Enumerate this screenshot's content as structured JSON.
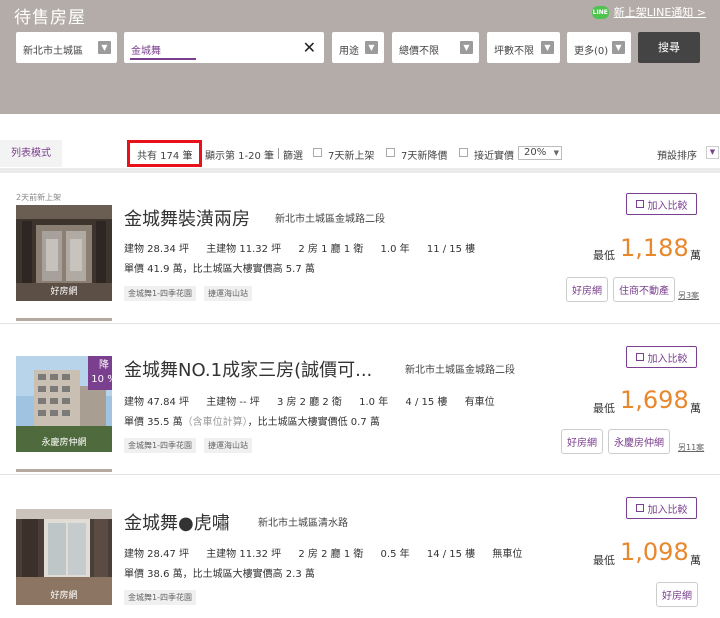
{
  "header": {
    "title": "待售房屋",
    "line_badge": "LINE",
    "line_link": "新上架LINE通知 >"
  },
  "filters": {
    "region": "新北市土城區",
    "keyword": "金城舞",
    "usage": "用途",
    "total_price": "總價不限",
    "ping": "坪數不限",
    "more": "更多(0)",
    "search_button": "搜尋"
  },
  "toolbar": {
    "list_mode": "列表模式",
    "total": "共有 174 筆",
    "showing": "顯示第 1-20 筆",
    "filter": "篩選",
    "new_7days": "7天新上架",
    "price_drop_7days": "7天新降價",
    "near_actual": "接近實價",
    "pct": "20%",
    "sort": "預設排序"
  },
  "listings": [
    {
      "tagline": "2天前新上架",
      "title": "金城舞裝潢兩房",
      "address": "新北市土城區金城路二段",
      "specs": [
        "建物 28.34 坪",
        "主建物 11.32 坪",
        "2 房 1 廳 1 衛",
        "1.0 年",
        "11 / 15 樓"
      ],
      "unit_price": "單價 41.9 萬，比土城區大樓實價高 5.7 萬",
      "unit_note": "",
      "tags": [
        "金城舞1-四季花園",
        "捷運海山站"
      ],
      "compare": "加入比較",
      "price_low_label": "最低",
      "price": "1,188",
      "price_unit": "萬",
      "agents": [
        "好房網",
        "住商不動產"
      ],
      "more_cases": "另3案",
      "thumb_brand": "好房網"
    },
    {
      "tagline": "",
      "title": "金城舞NO.1成家三房(誠價可...",
      "address": "新北市土城區金城路二段",
      "specs": [
        "建物 47.84 坪",
        "主建物 -- 坪",
        "3 房 2 廳 2 衛",
        "1.0 年",
        "4 / 15 樓",
        "有車位"
      ],
      "unit_price": "單價 35.5 萬",
      "unit_note": "（含車位計算）",
      "unit_rest": "，比土城區大樓實價低 0.7 萬",
      "tags": [
        "金城舞1-四季花園",
        "捷運海山站"
      ],
      "compare": "加入比較",
      "price_low_label": "最低",
      "price": "1,698",
      "price_unit": "萬",
      "agents": [
        "好房網",
        "永慶房仲網"
      ],
      "more_cases": "另11案",
      "thumb_brand": "永慶房仲網",
      "discount": [
        "降",
        "10 %"
      ]
    },
    {
      "tagline": "",
      "title": "金城舞●虎嘯",
      "address": "新北市土城區清水路",
      "specs": [
        "建物 28.47 坪",
        "主建物 11.32 坪",
        "2 房 2 廳 1 衛",
        "0.5 年",
        "14 / 15 樓",
        "無車位"
      ],
      "unit_price": "單價 38.6 萬，比土城區大樓實價高 2.3 萬",
      "unit_note": "",
      "tags": [
        "金城舞1-四季花園"
      ],
      "compare": "加入比較",
      "price_low_label": "最低",
      "price": "1,098",
      "price_unit": "萬",
      "agents": [
        "好房網"
      ],
      "more_cases": "",
      "thumb_brand": "好房網"
    }
  ],
  "colors": {
    "header_bg": "#b4aca8",
    "accent_purple": "#7b3f8f",
    "price_orange": "#e8872c",
    "highlight_red": "#e8101a"
  }
}
